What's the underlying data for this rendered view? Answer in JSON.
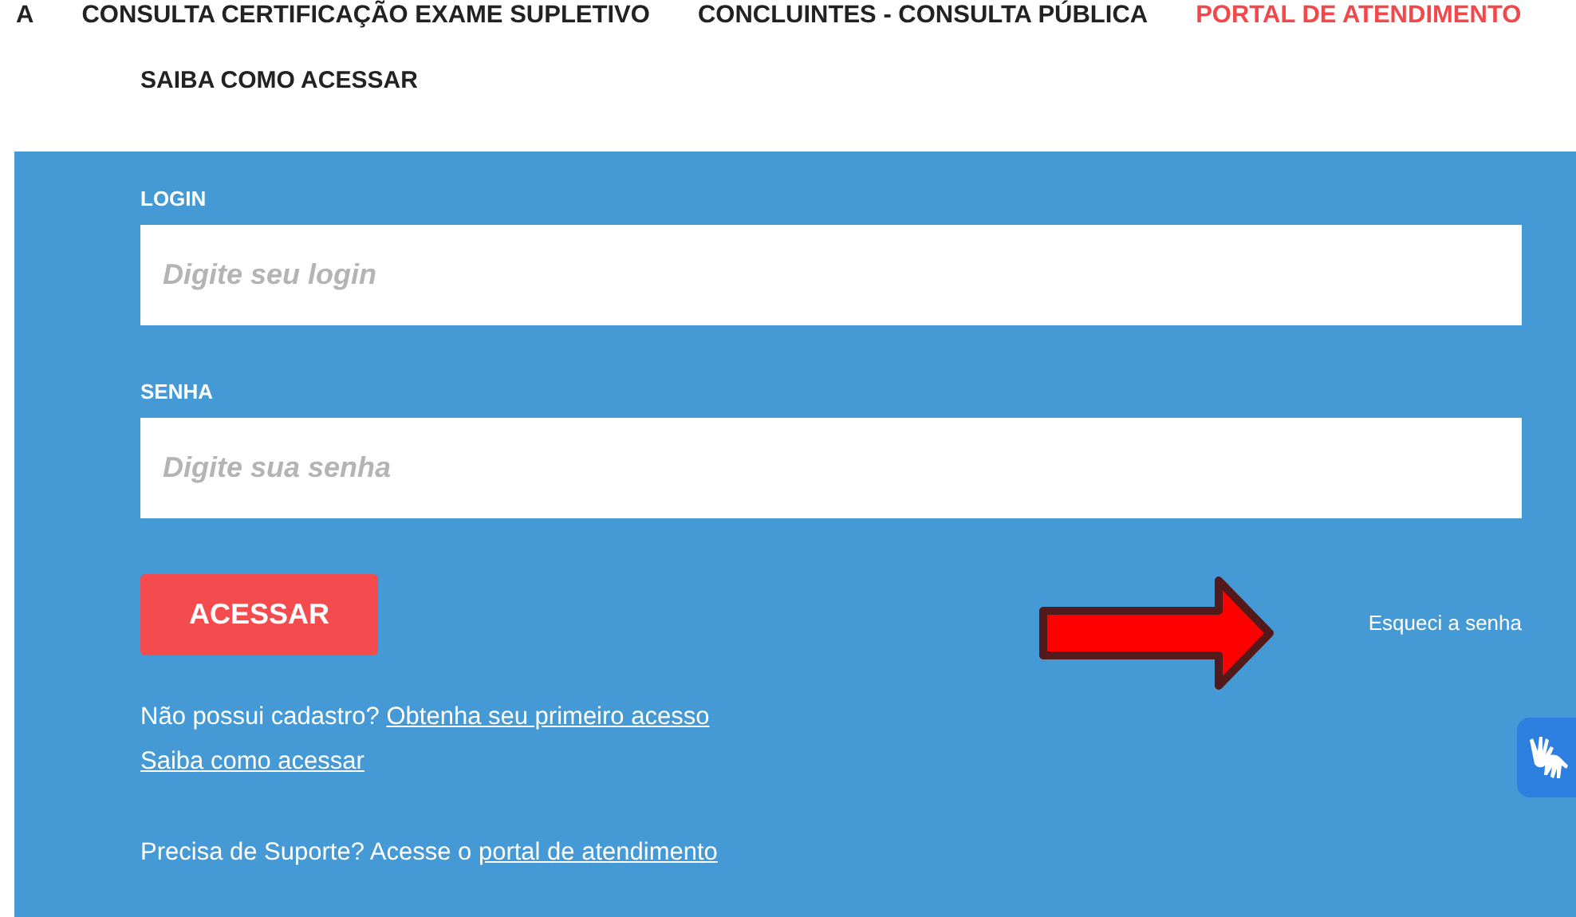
{
  "nav": {
    "items": [
      {
        "label": "A",
        "selected": false
      },
      {
        "label": "CONSULTA CERTIFICAÇÃO EXAME SUPLETIVO",
        "selected": false
      },
      {
        "label": "CONCLUINTES - CONSULTA PÚBLICA",
        "selected": false
      },
      {
        "label": "PORTAL DE ATENDIMENTO",
        "selected": true
      }
    ],
    "sub_link": "SAIBA COMO ACESSAR"
  },
  "form": {
    "fields": [
      {
        "label": "LOGIN",
        "placeholder": "Digite seu login"
      },
      {
        "label": "SENHA",
        "placeholder": "Digite sua senha"
      }
    ],
    "submit": "ACESSAR",
    "forgot": "Esqueci a senha",
    "lines": [
      [
        {
          "text": "Não possui cadastro? ",
          "link": false
        },
        {
          "text": "Obtenha seu primeiro acesso",
          "link": true
        }
      ],
      [
        {
          "text": "Saiba como acessar",
          "link": true
        }
      ],
      [
        {
          "text": "Precisa de Suporte? Acesse o ",
          "link": false
        },
        {
          "text": "portal de atendimento",
          "link": true
        }
      ]
    ]
  }
}
